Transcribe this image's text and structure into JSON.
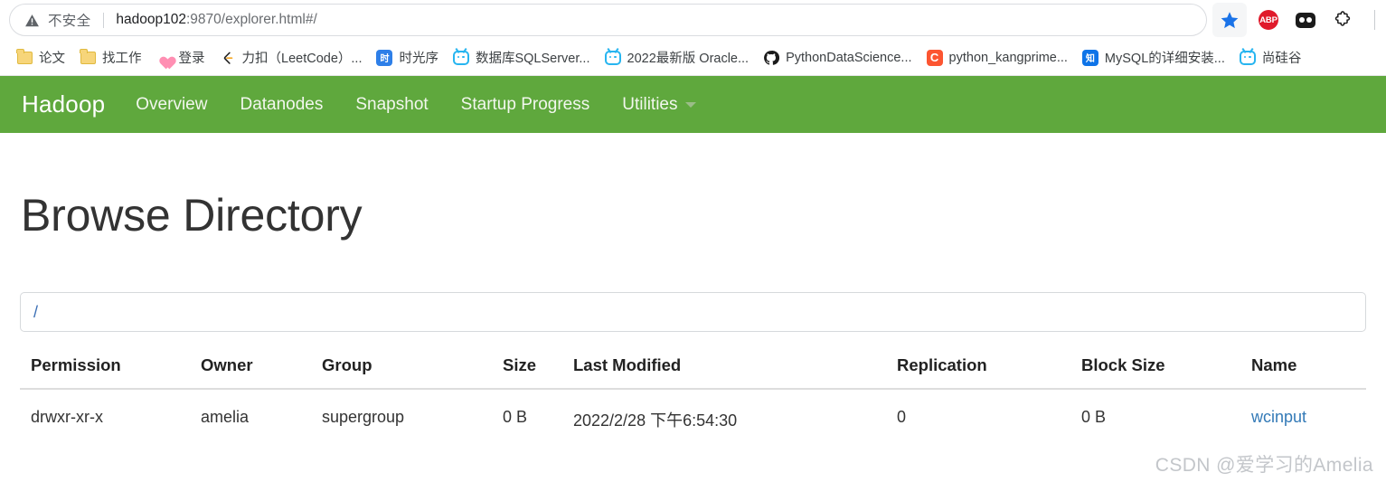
{
  "browser": {
    "security_label": "不安全",
    "url_host": "hadoop102",
    "url_rest": ":9870/explorer.html#/",
    "url_full": "hadoop102:9870/explorer.html#/",
    "star_icon": "bookmark-star-icon",
    "extensions": [
      {
        "name": "adblock-plus",
        "label": "ABP"
      },
      {
        "name": "dark-extension",
        "label": ""
      },
      {
        "name": "extensions-puzzle",
        "label": ""
      }
    ],
    "bookmarks": [
      {
        "label": "论文",
        "icon": "folder-icon"
      },
      {
        "label": "找工作",
        "icon": "folder-icon"
      },
      {
        "label": "登录",
        "icon": "heart-icon"
      },
      {
        "label": "力扣（LeetCode）...",
        "icon": "leetcode-icon"
      },
      {
        "label": "时光序",
        "icon": "shiguangxu-icon"
      },
      {
        "label": "数据库SQLServer...",
        "icon": "bilibili-icon"
      },
      {
        "label": "2022最新版 Oracle...",
        "icon": "bilibili-icon"
      },
      {
        "label": "PythonDataScience...",
        "icon": "github-icon"
      },
      {
        "label": "python_kangprime...",
        "icon": "csdn-icon"
      },
      {
        "label": "MySQL的详细安装...",
        "icon": "zhihu-icon"
      },
      {
        "label": "尚硅谷",
        "icon": "bilibili-icon"
      }
    ]
  },
  "navbar": {
    "brand": "Hadoop",
    "accent_color": "#5fa83d",
    "items": [
      {
        "label": "Overview",
        "has_caret": false
      },
      {
        "label": "Datanodes",
        "has_caret": false
      },
      {
        "label": "Snapshot",
        "has_caret": false
      },
      {
        "label": "Startup Progress",
        "has_caret": false
      },
      {
        "label": "Utilities",
        "has_caret": true
      }
    ]
  },
  "main": {
    "title": "Browse Directory",
    "path_value": "/",
    "table": {
      "columns": [
        "Permission",
        "Owner",
        "Group",
        "Size",
        "Last Modified",
        "Replication",
        "Block Size",
        "Name"
      ],
      "rows": [
        {
          "permission": "drwxr-xr-x",
          "owner": "amelia",
          "group": "supergroup",
          "size": "0 B",
          "last_modified": "2022/2/28 下午6:54:30",
          "replication": "0",
          "block_size": "0 B",
          "name": "wcinput",
          "name_color": "#337ab7"
        }
      ]
    }
  },
  "watermark": {
    "text": "CSDN @爱学习的Amelia"
  }
}
